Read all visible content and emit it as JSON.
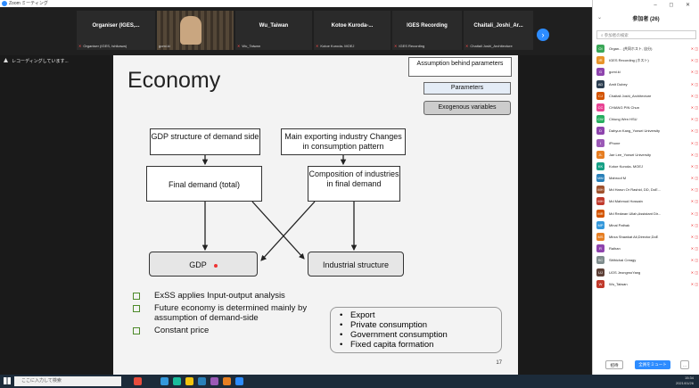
{
  "window": {
    "title": "Zoom ミーティング"
  },
  "video_strip": {
    "tiles": [
      {
        "name": "Organiser (IGES,...",
        "footer": "Organiser (IGES, Ishikawa)"
      },
      {
        "name": "",
        "footer": "gomi.ki"
      },
      {
        "name": "Wu_Taiwan",
        "footer": "Wu_Taiwan"
      },
      {
        "name": "Kotoe Kuroda-...",
        "footer": "Kotoe Kuroda- MOEJ"
      },
      {
        "name": "IGES Recording",
        "footer": "IGES Recording"
      },
      {
        "name": "Chaitali_Joshi_Ar...",
        "footer": "Chaitali Joshi_Architecture"
      }
    ],
    "next_glyph": "›"
  },
  "recording": {
    "label": "レコーディングしています..."
  },
  "slide": {
    "title": "Economy",
    "tag_assumption": "Assumption behind parameters",
    "tag_parameters": "Parameters",
    "tag_exogenous": "Exogenous variables",
    "box_gdp_structure": "GDP structure of demand side",
    "box_exporting": "Main exporting industry Changes in consumption pattern",
    "box_final_demand": "Final demand (total)",
    "box_composition": "Composition of industries in final demand",
    "box_gdp": "GDP",
    "box_industrial": "Industrial structure",
    "bullets": [
      "ExSS applies Input-output analysis",
      "Future economy is determined mainly by assumption of demand-side",
      "Constant price"
    ],
    "drivers": [
      "Export",
      "Private consumption",
      "Government consumption",
      "Fixed capita formation"
    ],
    "page_number": "17"
  },
  "sidebar": {
    "title": "参加者 (26)",
    "search_placeholder": "参加者の検索",
    "window_controls": "– ◻ ✕",
    "participants": [
      {
        "initials": "OI",
        "color": "#3aa757",
        "name": "Organ... (共同ホスト, 自分)"
      },
      {
        "initials": "IR",
        "color": "#e8942a",
        "name": "IGES Recording (ホスト)"
      },
      {
        "initials": "G",
        "color": "#8e44ad",
        "name": "gomi.ki"
      },
      {
        "initials": "AD",
        "color": "#2c3e50",
        "name": "Amit Dubey"
      },
      {
        "initials": "CJ",
        "color": "#d35400",
        "name": "Chaitali Joshi_Architecture"
      },
      {
        "initials": "CC",
        "color": "#e84393",
        "name": "CHIANG PIN Chun"
      },
      {
        "initials": "CW",
        "color": "#27ae60",
        "name": "Chiung Wen HSU"
      },
      {
        "initials": "D",
        "color": "#8e44ad",
        "name": "Dahyun Kang_Yonsei University"
      },
      {
        "initials": "I",
        "color": "#9b59b6",
        "name": "iPhone"
      },
      {
        "initials": "JL",
        "color": "#e67e22",
        "name": "Jae Lee_Yonsei University"
      },
      {
        "initials": "KK",
        "color": "#16a085",
        "name": "Kotoe Kuroda- MOEJ"
      },
      {
        "initials": "MM",
        "color": "#2980b9",
        "name": "Mahroof M"
      },
      {
        "initials": "MH",
        "color": "#a0522d",
        "name": "Md Harun Or Rashid, DD, DoE..."
      },
      {
        "initials": "MH",
        "color": "#c0392b",
        "name": "Md Mahmud Hossain"
      },
      {
        "initials": "MR",
        "color": "#d35400",
        "name": "Md Redwan Ullah,Assistant Dir..."
      },
      {
        "initials": "MP",
        "color": "#3498db",
        "name": "Minal Pathak"
      },
      {
        "initials": "MS",
        "color": "#e67e22",
        "name": "Mirza Shawkat Ali,Director,DoE"
      },
      {
        "initials": "R",
        "color": "#8e44ad",
        "name": "Raihan"
      },
      {
        "initials": "SC",
        "color": "#7f8c8d",
        "name": "Sitthichai Creagy"
      },
      {
        "initials": "UJ",
        "color": "#5d4037",
        "name": "UOS JeongmoYang"
      },
      {
        "initials": "W",
        "color": "#c0392b",
        "name": "Wu_Taiwan"
      }
    ],
    "invite_label": "招待",
    "mute_all_label": "全員をミュート",
    "more_label": "..."
  },
  "taskbar": {
    "search_placeholder": "ここに入力して検索",
    "time": "15:34",
    "date": "2021/01/26"
  }
}
